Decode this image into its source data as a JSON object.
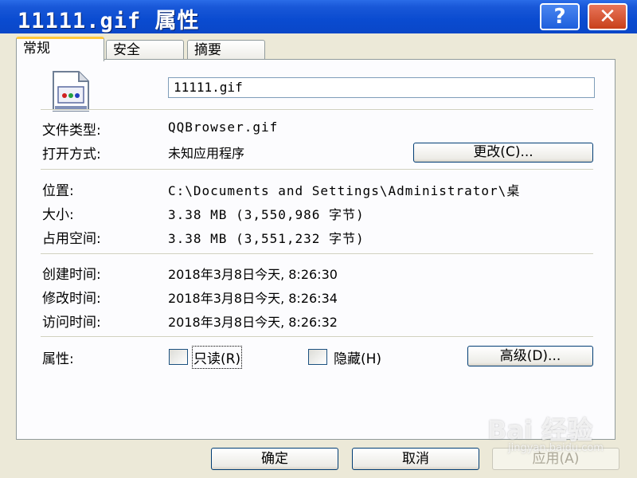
{
  "window": {
    "title": "11111.gif 属性",
    "help_glyph": "?",
    "close_glyph": "✕"
  },
  "tabs": [
    {
      "label": "常规",
      "active": true
    },
    {
      "label": "安全",
      "active": false
    },
    {
      "label": "摘要",
      "active": false
    }
  ],
  "general": {
    "file_icon": "gif-file-icon",
    "file_name": "11111.gif",
    "type_label": "文件类型:",
    "type_value": "QQBrowser.gif",
    "open_with_label": "打开方式:",
    "open_with_value": "未知应用程序",
    "change_button": "更改(C)...",
    "location_label": "位置:",
    "location_value": "C:\\Documents and Settings\\Administrator\\桌",
    "size_label": "大小:",
    "size_value": "3.38 MB (3,550,986 字节)",
    "disk_size_label": "占用空间:",
    "disk_size_value": "3.38 MB (3,551,232 字节)",
    "created_label": "创建时间:",
    "created_value": "2018年3月8日今天, 8:26:30",
    "modified_label": "修改时间:",
    "modified_value": "2018年3月8日今天, 8:26:34",
    "accessed_label": "访问时间:",
    "accessed_value": "2018年3月8日今天, 8:26:32",
    "attributes_label": "属性:",
    "readonly_label": "只读(R)",
    "readonly_checked": false,
    "hidden_label": "隐藏(H)",
    "hidden_checked": false,
    "advanced_button": "高级(D)..."
  },
  "footer": {
    "ok": "确定",
    "cancel": "取消",
    "apply": "应用(A)"
  },
  "watermark": {
    "brand": "Bai 经验",
    "sub": "jingyan.baidu.com"
  },
  "colors": {
    "title_bar": "#0A4BD0",
    "close_button": "#C8401A",
    "tab_highlight": "#FFC83C",
    "dialog_bg": "#ECE9D8"
  }
}
